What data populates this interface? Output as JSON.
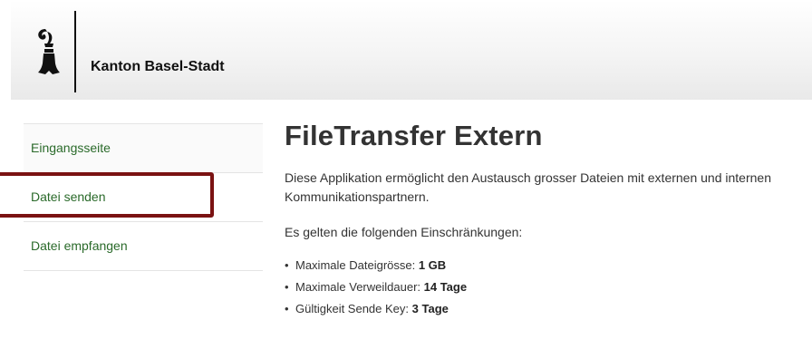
{
  "header": {
    "org_name": "Kanton Basel-Stadt",
    "logo_icon": "basel-staff-icon"
  },
  "sidebar": {
    "items": [
      {
        "label": "Eingangsseite"
      },
      {
        "label": "Datei senden"
      },
      {
        "label": "Datei empfangen"
      }
    ],
    "highlighted_item": "Datei senden"
  },
  "main": {
    "title": "FileTransfer Extern",
    "intro": "Diese Applikation ermöglicht den Austausch grosser Dateien mit externen und internen Kommunikationspartnern.",
    "restrictions_heading": "Es gelten die folgenden Einschränkungen:",
    "restrictions": [
      {
        "label": "Maximale Dateigrösse: ",
        "value": "1 GB"
      },
      {
        "label": "Maximale Verweildauer: ",
        "value": "14 Tage"
      },
      {
        "label": "Gültigkeit Sende Key: ",
        "value": "3 Tage"
      }
    ]
  },
  "colors": {
    "link": "#2a6a2a",
    "highlight": "#7a1212"
  }
}
